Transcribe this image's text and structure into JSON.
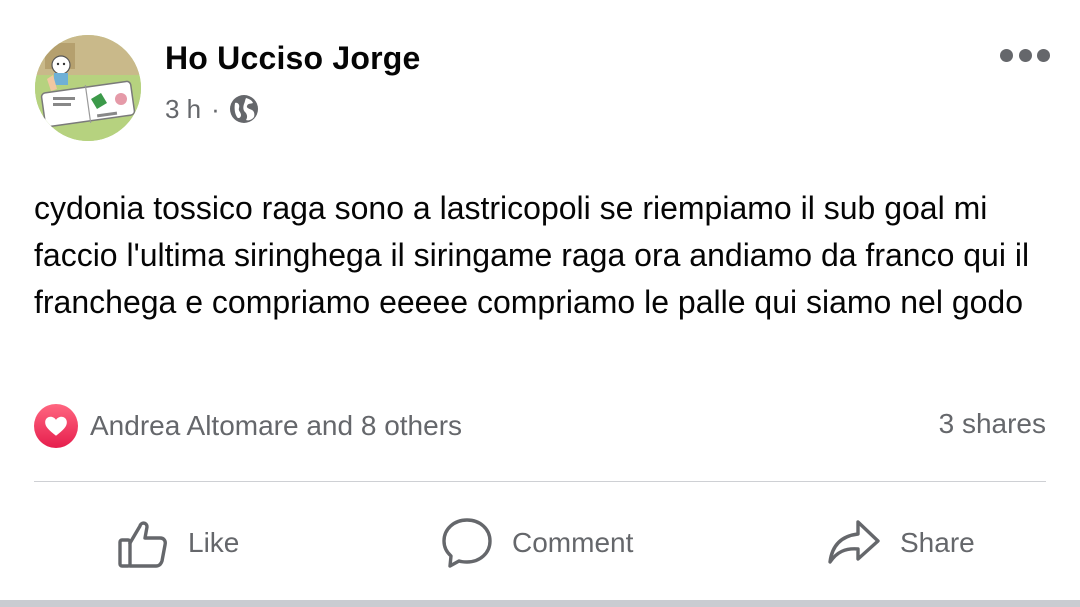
{
  "post": {
    "author": "Ho Ucciso Jorge",
    "time": "3 h",
    "separator": "·",
    "privacy_icon": "globe-icon",
    "menu_icon": "more-options-icon",
    "avatar_icon": "cartoon-avatar",
    "text": "cydonia tossico raga sono a lastricopoli se riempiamo il sub goal mi faccio l'ultima siringhega il siringame raga ora andiamo da franco qui il franchega e compriamo eeeee compriamo le palle qui siamo nel godo"
  },
  "reactions": {
    "icon": "heart-reaction-icon",
    "text": "Andrea Altomare and 8 others",
    "shares": "3 shares"
  },
  "actions": {
    "like": "Like",
    "comment": "Comment",
    "share": "Share"
  },
  "colors": {
    "text_primary": "#050505",
    "text_secondary": "#65676b",
    "love_red": "#f33e58",
    "divider": "#ced0d4"
  }
}
